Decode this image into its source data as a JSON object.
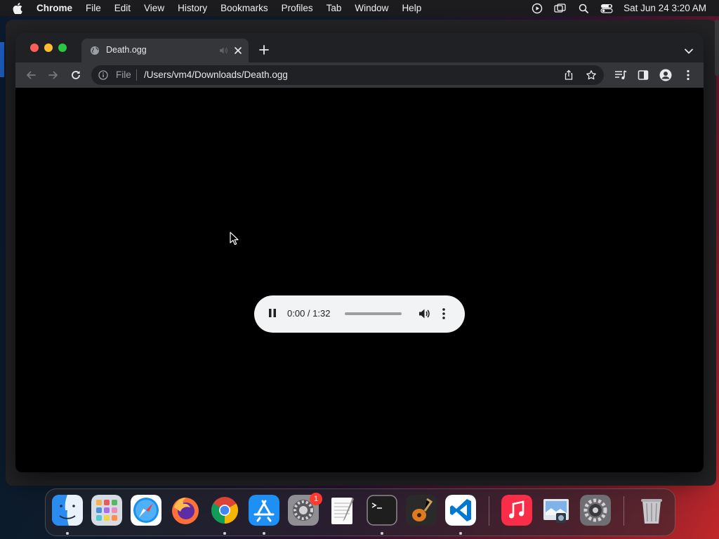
{
  "menubar": {
    "app_name": "Chrome",
    "items": [
      "File",
      "Edit",
      "View",
      "History",
      "Bookmarks",
      "Profiles",
      "Tab",
      "Window",
      "Help"
    ],
    "clock": "Sat Jun 24  3:20 AM"
  },
  "browser": {
    "tab": {
      "title": "Death.ogg"
    },
    "omnibox": {
      "scheme_label": "File",
      "url": "/Users/vm4/Downloads/Death.ogg"
    }
  },
  "player": {
    "time_display": "0:00 / 1:32",
    "progress_fraction": 0.0,
    "state": "playing"
  },
  "dock": {
    "apps": [
      {
        "name": "Finder",
        "icon": "finder-icon",
        "running": true
      },
      {
        "name": "Launchpad",
        "icon": "launchpad-icon",
        "running": false
      },
      {
        "name": "Safari",
        "icon": "safari-icon",
        "running": false
      },
      {
        "name": "Firefox",
        "icon": "firefox-icon",
        "running": false
      },
      {
        "name": "Google Chrome",
        "icon": "chrome-icon",
        "running": true
      },
      {
        "name": "App Store",
        "icon": "app-store-icon",
        "running": true
      },
      {
        "name": "System Preferences",
        "icon": "system-preferences-icon",
        "running": false,
        "badge": "1"
      },
      {
        "name": "TextEdit",
        "icon": "textedit-icon",
        "running": false
      },
      {
        "name": "Terminal",
        "icon": "terminal-icon",
        "running": true
      },
      {
        "name": "GarageBand",
        "icon": "garageband-icon",
        "running": false
      },
      {
        "name": "Visual Studio Code",
        "icon": "vscode-icon",
        "running": true
      },
      {
        "name": "Music",
        "icon": "music-icon",
        "running": false
      },
      {
        "name": "Preview",
        "icon": "preview-icon",
        "running": false
      },
      {
        "name": "System Settings",
        "icon": "settings-gear-icon",
        "running": false
      },
      {
        "name": "Trash",
        "icon": "trash-icon",
        "running": false
      }
    ]
  },
  "colors": {
    "menubar_bg": "#1c1c1e",
    "tabstrip_bg": "#202124",
    "toolbar_bg": "#35363a",
    "player_bg": "#f1f3f4",
    "badge_red": "#ff3b30"
  }
}
